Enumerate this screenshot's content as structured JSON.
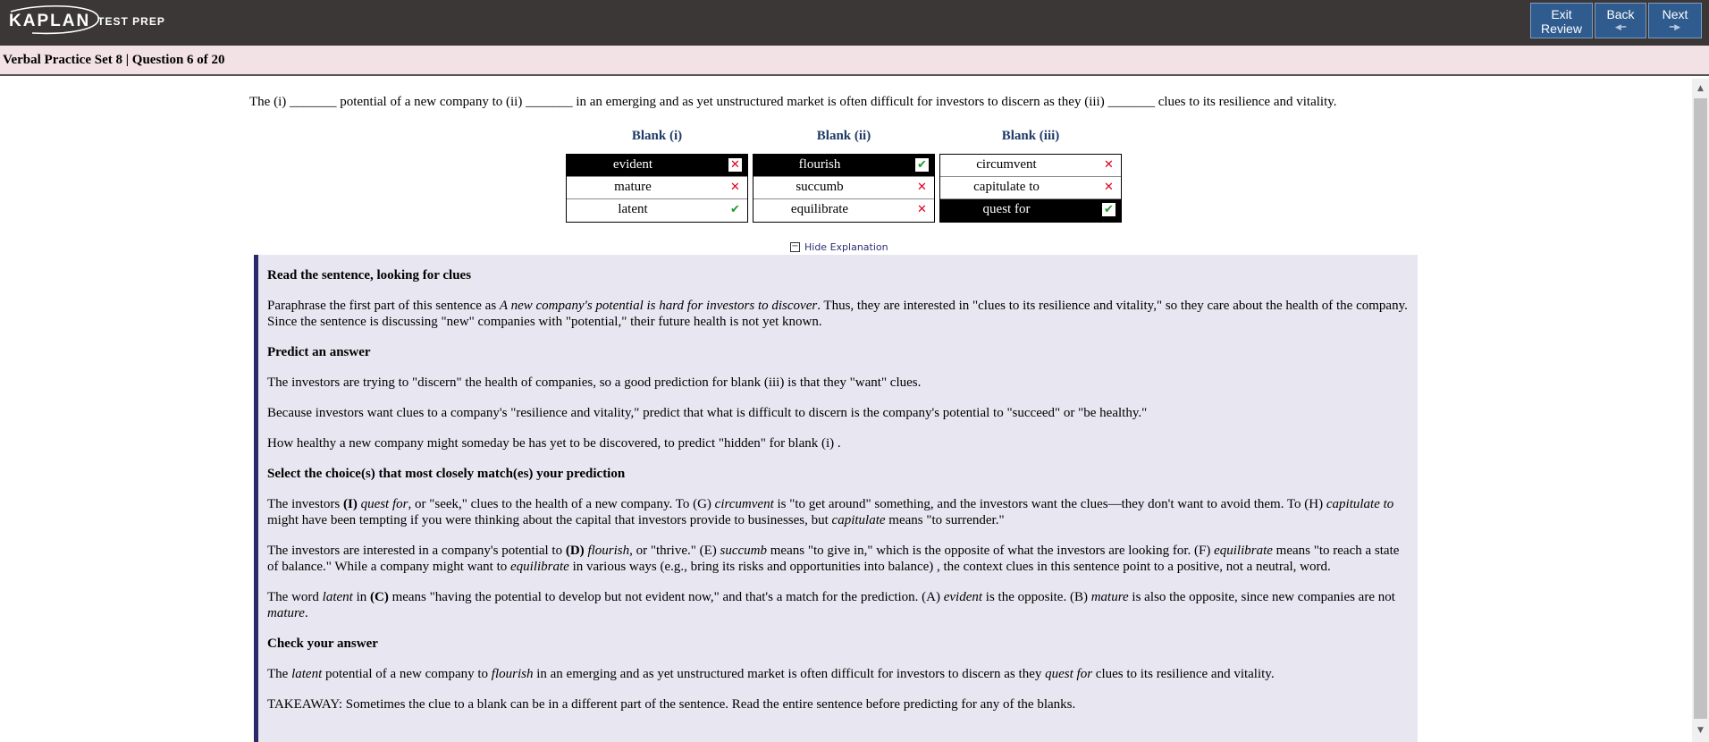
{
  "header": {
    "brand": "KAPLAN",
    "brand_sub": "TEST PREP",
    "buttons": {
      "exit_line1": "Exit",
      "exit_line2": "Review",
      "back": "Back",
      "next": "Next"
    }
  },
  "subheader": {
    "title": "Verbal Practice Set 8 | Question 6 of 20"
  },
  "question": {
    "text": "The (i) _______ potential of a new company to (ii) _______ in an emerging and as yet unstructured market is often difficult for investors to discern as they (iii) _______ clues to its resilience and vitality."
  },
  "blanks": [
    {
      "header": "Blank (i)",
      "choices": [
        {
          "label": "evident",
          "selected": true,
          "mark": "x"
        },
        {
          "label": "mature",
          "selected": false,
          "mark": "x"
        },
        {
          "label": "latent",
          "selected": false,
          "mark": "check"
        }
      ]
    },
    {
      "header": "Blank (ii)",
      "choices": [
        {
          "label": "flourish",
          "selected": true,
          "mark": "check"
        },
        {
          "label": "succumb",
          "selected": false,
          "mark": "x"
        },
        {
          "label": "equilibrate",
          "selected": false,
          "mark": "x"
        }
      ]
    },
    {
      "header": "Blank (iii)",
      "choices": [
        {
          "label": "circumvent",
          "selected": false,
          "mark": "x"
        },
        {
          "label": "capitulate to",
          "selected": false,
          "mark": "x"
        },
        {
          "label": "quest for",
          "selected": true,
          "mark": "check"
        }
      ]
    }
  ],
  "explanation_toggle": "Hide Explanation",
  "explanation": {
    "h1": "Read the sentence, looking for clues",
    "p1a": "Paraphrase the first part of this sentence as ",
    "p1b": "A new company's potential is hard for investors to discover",
    "p1c": ". Thus, they are interested in \"clues to its resilience and vitality,\" so they care about the health of the company. Since the sentence is discussing \"new\" companies with \"potential,\" their future health is not yet known.",
    "h2": "Predict an answer",
    "p2": "The investors are trying to \"discern\" the health of companies, so a good prediction for blank (iii) is that they \"want\" clues.",
    "p3": "Because investors want clues to a company's \"resilience and vitality,\" predict that what is difficult to discern is the company's potential to \"succeed\" or \"be healthy.\"",
    "p4": "How healthy a new company might someday be has yet to be discovered, to predict \"hidden\" for blank (i) .",
    "h3": "Select the choice(s) that most closely match(es) your prediction",
    "p5a": "The investors ",
    "p5b": "(I)",
    "p5c": "quest for",
    "p5d": ", or \"seek,\" clues to the health of a new company. To (G) ",
    "p5e": "circumvent",
    "p5f": " is \"to get around\" something, and the investors want the clues—they don't want to avoid them. To (H) ",
    "p5g": "capitulate to",
    "p5h": " might have been tempting if you were thinking about the capital that investors provide to businesses, but ",
    "p5i": "capitulate",
    "p5j": " means \"to surrender.\"",
    "p6a": "The investors are interested in a company's potential to ",
    "p6b": "(D)",
    "p6c": "flourish",
    "p6d": ", or \"thrive.\" (E) ",
    "p6e": "succumb",
    "p6f": " means \"to give in,\" which is the opposite of what the investors are looking for. (F) ",
    "p6g": "equilibrate",
    "p6h": " means \"to reach a state of balance.\" While a company might want to ",
    "p6i": "equilibrate",
    "p6j": " in various ways (e.g., bring its risks and opportunities into balance) , the context clues in this sentence point to a positive, not a neutral, word.",
    "p7a": "The word ",
    "p7b": "latent",
    "p7c": " in ",
    "p7d": "(C)",
    "p7e": " means \"having the potential to develop but not evident now,\" and that's a match for the prediction. (A) ",
    "p7f": "evident",
    "p7g": " is the opposite. (B) ",
    "p7h": "mature",
    "p7i": " is also the opposite, since new companies are not ",
    "p7j": "mature",
    "p7k": ".",
    "h4": "Check your answer",
    "p8a": "The ",
    "p8b": "latent",
    "p8c": " potential of a new company to ",
    "p8d": "flourish",
    "p8e": " in an emerging and as yet unstructured market is often difficult for investors to discern as they ",
    "p8f": "quest for",
    "p8g": " clues to its resilience and vitality.",
    "p9": "TAKEAWAY: Sometimes the clue to a blank can be in a different part of the sentence. Read the entire sentence before predicting for any of the blanks."
  }
}
